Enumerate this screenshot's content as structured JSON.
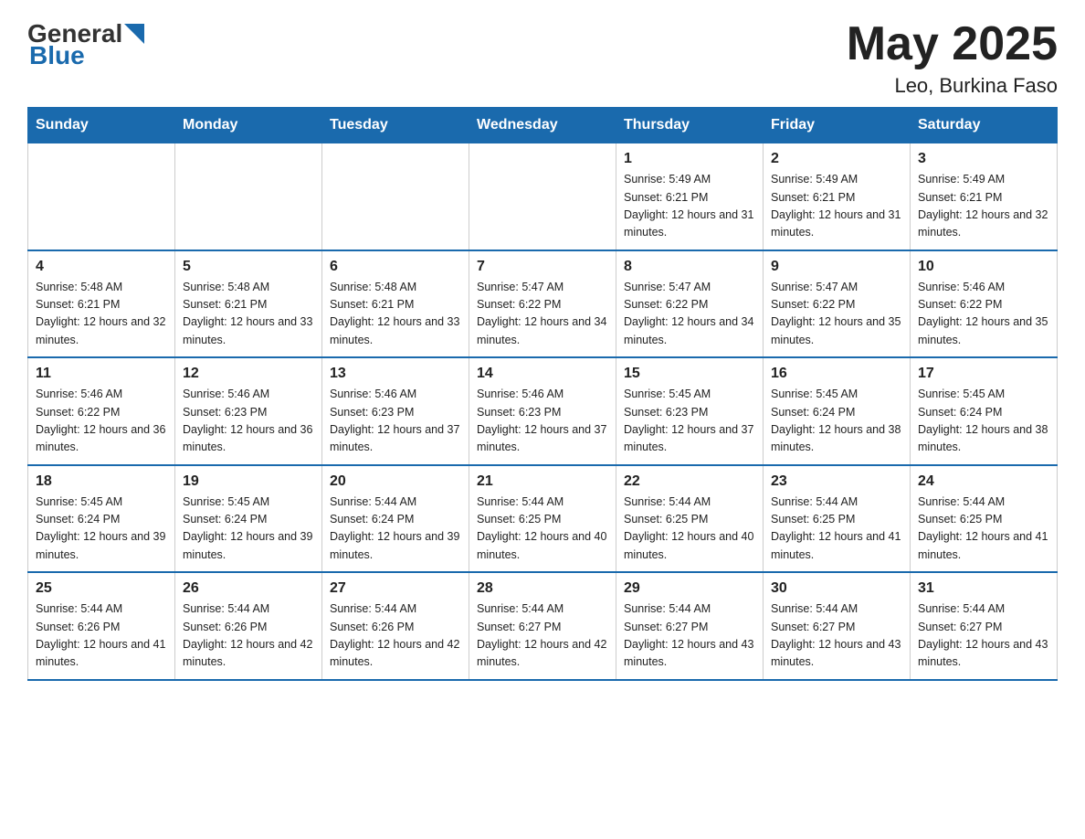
{
  "header": {
    "logo_general": "General",
    "logo_blue": "Blue",
    "title": "May 2025",
    "subtitle": "Leo, Burkina Faso"
  },
  "days_of_week": [
    "Sunday",
    "Monday",
    "Tuesday",
    "Wednesday",
    "Thursday",
    "Friday",
    "Saturday"
  ],
  "weeks": [
    [
      {
        "day": "",
        "info": ""
      },
      {
        "day": "",
        "info": ""
      },
      {
        "day": "",
        "info": ""
      },
      {
        "day": "",
        "info": ""
      },
      {
        "day": "1",
        "info": "Sunrise: 5:49 AM\nSunset: 6:21 PM\nDaylight: 12 hours and 31 minutes."
      },
      {
        "day": "2",
        "info": "Sunrise: 5:49 AM\nSunset: 6:21 PM\nDaylight: 12 hours and 31 minutes."
      },
      {
        "day": "3",
        "info": "Sunrise: 5:49 AM\nSunset: 6:21 PM\nDaylight: 12 hours and 32 minutes."
      }
    ],
    [
      {
        "day": "4",
        "info": "Sunrise: 5:48 AM\nSunset: 6:21 PM\nDaylight: 12 hours and 32 minutes."
      },
      {
        "day": "5",
        "info": "Sunrise: 5:48 AM\nSunset: 6:21 PM\nDaylight: 12 hours and 33 minutes."
      },
      {
        "day": "6",
        "info": "Sunrise: 5:48 AM\nSunset: 6:21 PM\nDaylight: 12 hours and 33 minutes."
      },
      {
        "day": "7",
        "info": "Sunrise: 5:47 AM\nSunset: 6:22 PM\nDaylight: 12 hours and 34 minutes."
      },
      {
        "day": "8",
        "info": "Sunrise: 5:47 AM\nSunset: 6:22 PM\nDaylight: 12 hours and 34 minutes."
      },
      {
        "day": "9",
        "info": "Sunrise: 5:47 AM\nSunset: 6:22 PM\nDaylight: 12 hours and 35 minutes."
      },
      {
        "day": "10",
        "info": "Sunrise: 5:46 AM\nSunset: 6:22 PM\nDaylight: 12 hours and 35 minutes."
      }
    ],
    [
      {
        "day": "11",
        "info": "Sunrise: 5:46 AM\nSunset: 6:22 PM\nDaylight: 12 hours and 36 minutes."
      },
      {
        "day": "12",
        "info": "Sunrise: 5:46 AM\nSunset: 6:23 PM\nDaylight: 12 hours and 36 minutes."
      },
      {
        "day": "13",
        "info": "Sunrise: 5:46 AM\nSunset: 6:23 PM\nDaylight: 12 hours and 37 minutes."
      },
      {
        "day": "14",
        "info": "Sunrise: 5:46 AM\nSunset: 6:23 PM\nDaylight: 12 hours and 37 minutes."
      },
      {
        "day": "15",
        "info": "Sunrise: 5:45 AM\nSunset: 6:23 PM\nDaylight: 12 hours and 37 minutes."
      },
      {
        "day": "16",
        "info": "Sunrise: 5:45 AM\nSunset: 6:24 PM\nDaylight: 12 hours and 38 minutes."
      },
      {
        "day": "17",
        "info": "Sunrise: 5:45 AM\nSunset: 6:24 PM\nDaylight: 12 hours and 38 minutes."
      }
    ],
    [
      {
        "day": "18",
        "info": "Sunrise: 5:45 AM\nSunset: 6:24 PM\nDaylight: 12 hours and 39 minutes."
      },
      {
        "day": "19",
        "info": "Sunrise: 5:45 AM\nSunset: 6:24 PM\nDaylight: 12 hours and 39 minutes."
      },
      {
        "day": "20",
        "info": "Sunrise: 5:44 AM\nSunset: 6:24 PM\nDaylight: 12 hours and 39 minutes."
      },
      {
        "day": "21",
        "info": "Sunrise: 5:44 AM\nSunset: 6:25 PM\nDaylight: 12 hours and 40 minutes."
      },
      {
        "day": "22",
        "info": "Sunrise: 5:44 AM\nSunset: 6:25 PM\nDaylight: 12 hours and 40 minutes."
      },
      {
        "day": "23",
        "info": "Sunrise: 5:44 AM\nSunset: 6:25 PM\nDaylight: 12 hours and 41 minutes."
      },
      {
        "day": "24",
        "info": "Sunrise: 5:44 AM\nSunset: 6:25 PM\nDaylight: 12 hours and 41 minutes."
      }
    ],
    [
      {
        "day": "25",
        "info": "Sunrise: 5:44 AM\nSunset: 6:26 PM\nDaylight: 12 hours and 41 minutes."
      },
      {
        "day": "26",
        "info": "Sunrise: 5:44 AM\nSunset: 6:26 PM\nDaylight: 12 hours and 42 minutes."
      },
      {
        "day": "27",
        "info": "Sunrise: 5:44 AM\nSunset: 6:26 PM\nDaylight: 12 hours and 42 minutes."
      },
      {
        "day": "28",
        "info": "Sunrise: 5:44 AM\nSunset: 6:27 PM\nDaylight: 12 hours and 42 minutes."
      },
      {
        "day": "29",
        "info": "Sunrise: 5:44 AM\nSunset: 6:27 PM\nDaylight: 12 hours and 43 minutes."
      },
      {
        "day": "30",
        "info": "Sunrise: 5:44 AM\nSunset: 6:27 PM\nDaylight: 12 hours and 43 minutes."
      },
      {
        "day": "31",
        "info": "Sunrise: 5:44 AM\nSunset: 6:27 PM\nDaylight: 12 hours and 43 minutes."
      }
    ]
  ]
}
